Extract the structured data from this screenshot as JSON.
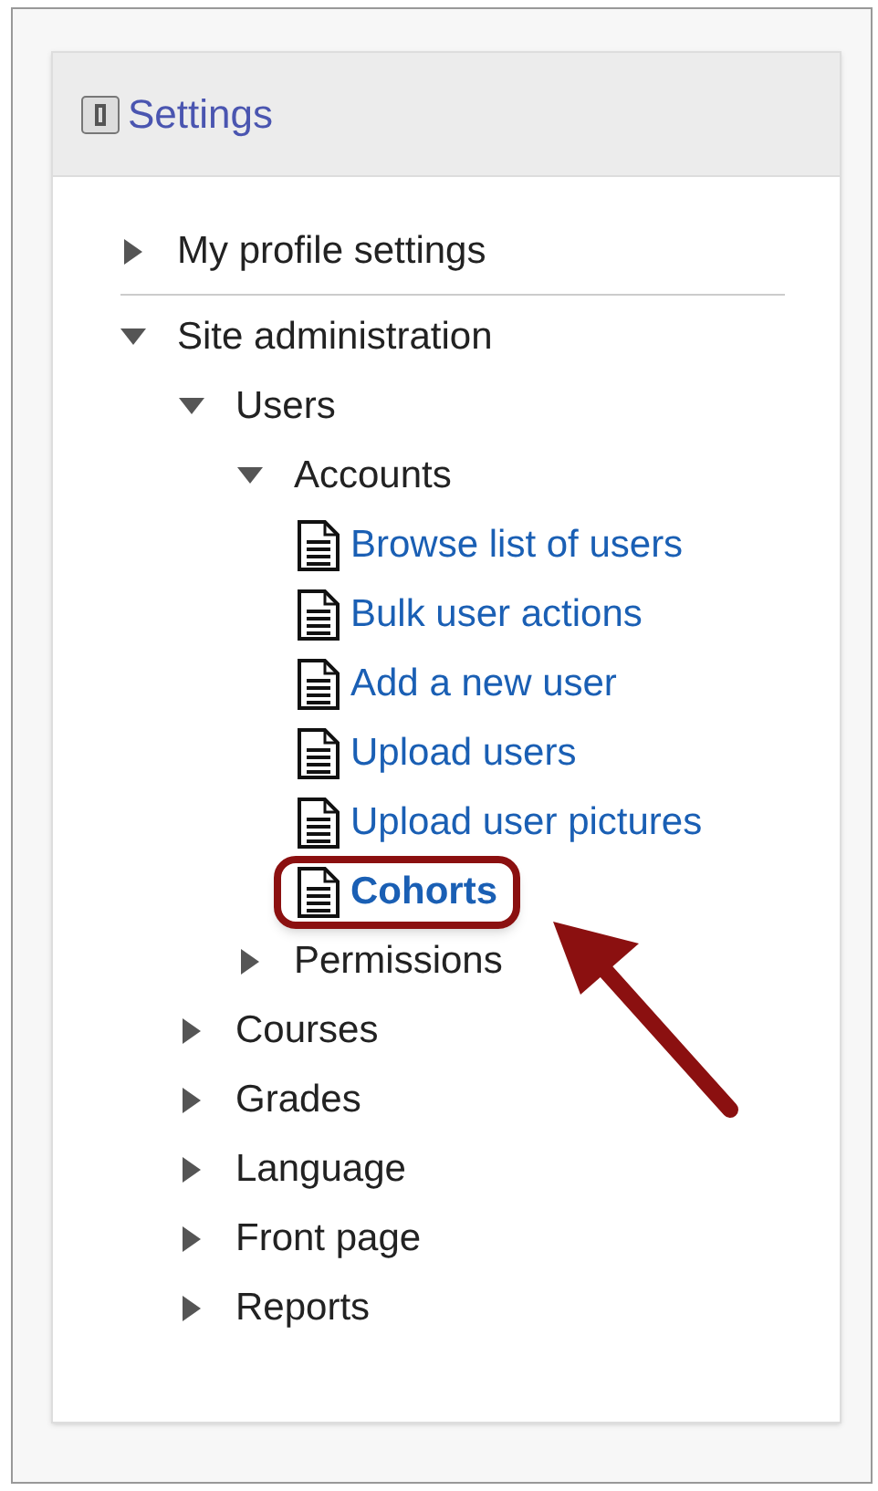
{
  "block": {
    "title": "Settings"
  },
  "tree": [
    {
      "label": "My profile settings",
      "kind": "branch",
      "expanded": false
    },
    {
      "label": "Site administration",
      "kind": "branch",
      "expanded": true,
      "children": [
        {
          "label": "Users",
          "kind": "branch",
          "expanded": true,
          "children": [
            {
              "label": "Accounts",
              "kind": "branch",
              "expanded": true,
              "children": [
                {
                  "label": "Browse list of users",
                  "kind": "link",
                  "highlighted": false
                },
                {
                  "label": "Bulk user actions",
                  "kind": "link",
                  "highlighted": false
                },
                {
                  "label": "Add a new user",
                  "kind": "link",
                  "highlighted": false
                },
                {
                  "label": "Upload users",
                  "kind": "link",
                  "highlighted": false
                },
                {
                  "label": "Upload user pictures",
                  "kind": "link",
                  "highlighted": false
                },
                {
                  "label": "Cohorts",
                  "kind": "link",
                  "highlighted": true
                }
              ]
            },
            {
              "label": "Permissions",
              "kind": "branch",
              "expanded": false
            }
          ]
        },
        {
          "label": "Courses",
          "kind": "branch",
          "expanded": false
        },
        {
          "label": "Grades",
          "kind": "branch",
          "expanded": false
        },
        {
          "label": "Language",
          "kind": "branch",
          "expanded": false
        },
        {
          "label": "Front page",
          "kind": "branch",
          "expanded": false
        },
        {
          "label": "Reports",
          "kind": "branch",
          "expanded": false
        }
      ]
    }
  ]
}
